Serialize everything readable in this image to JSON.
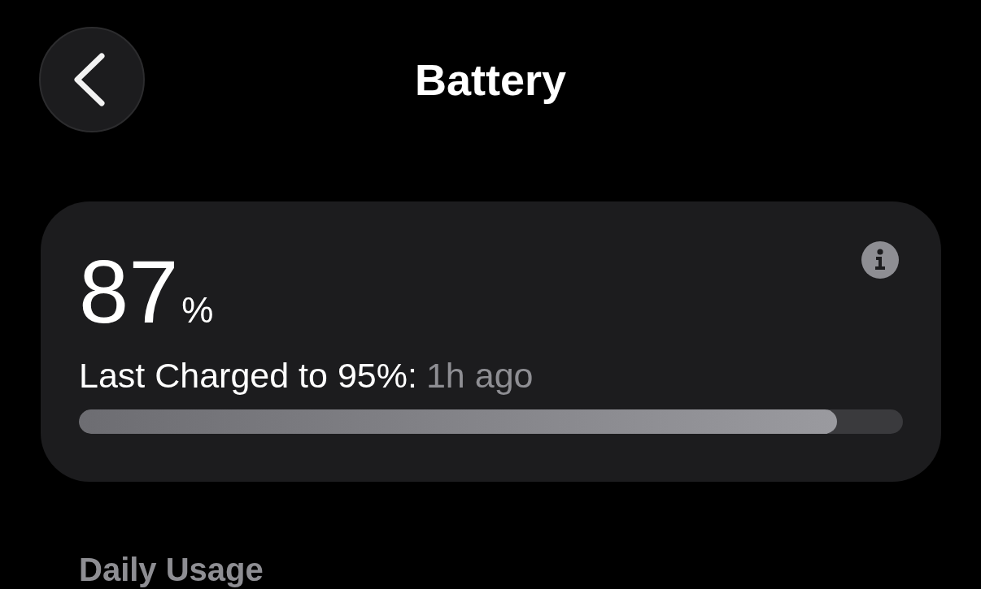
{
  "header": {
    "title": "Battery"
  },
  "battery_card": {
    "percentage": "87",
    "unit": "%",
    "last_charged": {
      "label": "Last Charged to 95%:",
      "time": "1h ago"
    },
    "level": 0.92
  },
  "daily_usage": {
    "title": "Daily Usage"
  }
}
